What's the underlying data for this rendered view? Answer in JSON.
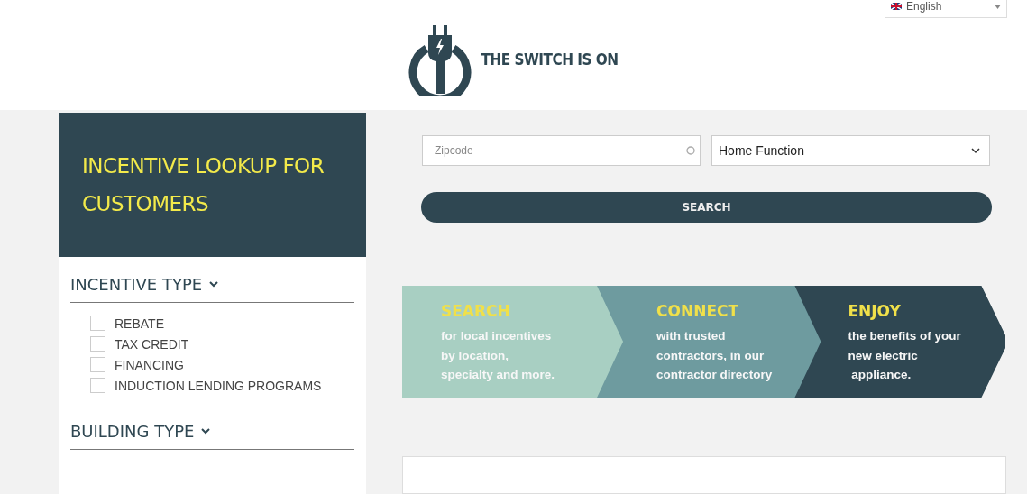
{
  "language": {
    "value": "English"
  },
  "logo": {
    "text": "THE SWITCH IS ON"
  },
  "sidebar": {
    "title": "INCENTIVE LOOKUP FOR CUSTOMERS",
    "sections": [
      {
        "title": "INCENTIVE TYPE",
        "options": [
          {
            "label": "REBATE",
            "checked": false
          },
          {
            "label": "TAX CREDIT",
            "checked": false
          },
          {
            "label": "FINANCING",
            "checked": false
          },
          {
            "label": "INDUCTION LENDING PROGRAMS",
            "checked": false
          }
        ]
      },
      {
        "title": "BUILDING TYPE"
      }
    ]
  },
  "search": {
    "zipcode": {
      "placeholder": "Zipcode"
    },
    "function": {
      "value": "Home Function"
    },
    "button": "SEARCH"
  },
  "steps": [
    {
      "title": "SEARCH",
      "lines": [
        "for local incentives",
        "by location,",
        "specialty and more."
      ],
      "color": "#a8cfc2"
    },
    {
      "title": "CONNECT",
      "lines": [
        "with trusted",
        "contractors, in our",
        "contractor directory"
      ],
      "color": "#6e9b9f"
    },
    {
      "title": "ENJOY",
      "lines": [
        "the benefits of your",
        "new electric",
        " appliance."
      ],
      "color": "#2f4752"
    }
  ]
}
